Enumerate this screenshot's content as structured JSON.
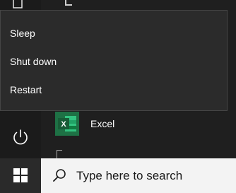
{
  "power_menu": {
    "items": [
      {
        "label": "Sleep"
      },
      {
        "label": "Shut down"
      },
      {
        "label": "Restart"
      }
    ]
  },
  "apps": {
    "excel": {
      "label": "Excel",
      "tile_color": "#1e7145",
      "icon": "excel-icon"
    }
  },
  "rail": {
    "power_icon": "power-icon",
    "document_icon": "document-icon"
  },
  "taskbar": {
    "start_icon": "windows-logo-icon",
    "search_placeholder": "Type here to search",
    "search_icon": "search-icon"
  },
  "colors": {
    "menu_bg": "#1f1f1f",
    "flyout_bg": "#2b2b2b",
    "taskbar_bg": "#2a2a2a",
    "search_bg": "#f3f3f3",
    "text": "#ffffff"
  }
}
